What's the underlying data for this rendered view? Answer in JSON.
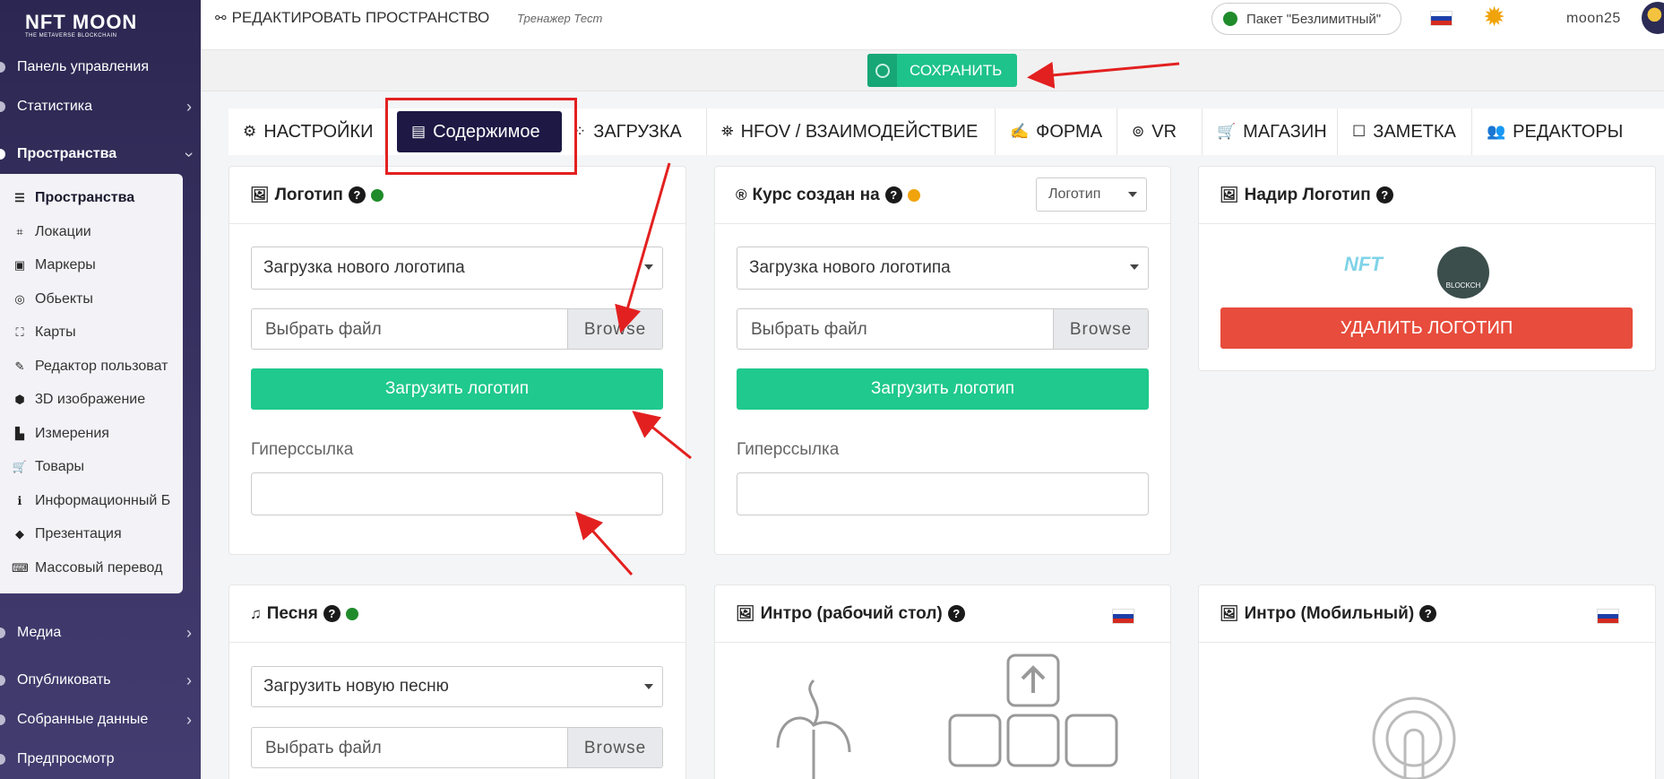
{
  "sidebar": {
    "logo_text": "NFT MOON",
    "logo_sub": "THE METAVERSE BLOCKCHAIN",
    "items": [
      {
        "label": "Панель управления",
        "chevron": false
      },
      {
        "label": "Статистика",
        "chevron": true
      },
      {
        "label": "Пространства",
        "chevron": true
      },
      {
        "label": "Медиа",
        "chevron": true
      },
      {
        "label": "Опубликовать",
        "chevron": true
      },
      {
        "label": "Собранные данные",
        "chevron": true
      },
      {
        "label": "Предпросмотр",
        "chevron": false
      }
    ],
    "sub_items": [
      {
        "label": "Пространства",
        "icon": "☰"
      },
      {
        "label": "Локации",
        "icon": "⌗"
      },
      {
        "label": "Маркеры",
        "icon": "▣"
      },
      {
        "label": "Обьекты",
        "icon": "◎"
      },
      {
        "label": "Карты",
        "icon": "⛶"
      },
      {
        "label": "Редактор пользоват",
        "icon": "✎"
      },
      {
        "label": "3D изображение",
        "icon": "⬢"
      },
      {
        "label": "Измерения",
        "icon": "▙"
      },
      {
        "label": "Товары",
        "icon": "🛒"
      },
      {
        "label": "Информационный Б",
        "icon": "ℹ"
      },
      {
        "label": "Презентация",
        "icon": "◆"
      },
      {
        "label": "Массовый перевод",
        "icon": "⌨"
      }
    ]
  },
  "header": {
    "title": "РЕДАКТИРОВАТЬ ПРОСТРАНСТВО",
    "subtitle": "Тренажер Тест",
    "package": "Пакет \"Безлимитный\"",
    "username": "moon25"
  },
  "save_label": "СОХРАНИТЬ",
  "tabs": [
    {
      "label": "НАСТРОЙКИ",
      "icon": "⚙"
    },
    {
      "label": "Содержимое",
      "icon": "▤"
    },
    {
      "label": "ЗАГРУЗКА",
      "icon": "⁘"
    },
    {
      "label": "HFOV / ВЗАИМОДЕЙСТВИЕ",
      "icon": "⛯"
    },
    {
      "label": "ФОРМА",
      "icon": "✍"
    },
    {
      "label": "VR",
      "icon": "⊚"
    },
    {
      "label": "МАГАЗИН",
      "icon": "🛒"
    },
    {
      "label": "ЗАМЕТКА",
      "icon": "☐"
    },
    {
      "label": "РЕДАКТОРЫ",
      "icon": "👥"
    }
  ],
  "cards": {
    "logo": {
      "title": "Логотип",
      "select": "Загрузка нового логотипа",
      "file_placeholder": "Выбрать файл",
      "browse": "Browse",
      "upload": "Загрузить логотип",
      "link_label": "Гиперссылка",
      "status_color": "#1f8b2b"
    },
    "course": {
      "title": "Курс создан на",
      "dropdown": "Логотип",
      "select": "Загрузка нового логотипа",
      "file_placeholder": "Выбрать файл",
      "browse": "Browse",
      "upload": "Загрузить логотип",
      "link_label": "Гиперссылка",
      "status_color": "#f0a30a"
    },
    "nadir": {
      "title": "Надир Логотип",
      "logo_text": "NFT",
      "logo2_text": "BLOCKCH",
      "delete": "УДАЛИТЬ ЛОГОТИП"
    },
    "song": {
      "title": "Песня",
      "select": "Загрузить новую песню",
      "file_placeholder": "Выбрать файл",
      "browse": "Browse",
      "status_color": "#1f8b2b"
    },
    "intro_desktop": {
      "title": "Интро (рабочий стол)"
    },
    "intro_mobile": {
      "title": "Интро (Мобильный)"
    }
  },
  "colors": {
    "accent_green": "#20c98d",
    "danger": "#e74c3c",
    "sidebar": "#2c2752",
    "active_tab": "#1d1944"
  }
}
